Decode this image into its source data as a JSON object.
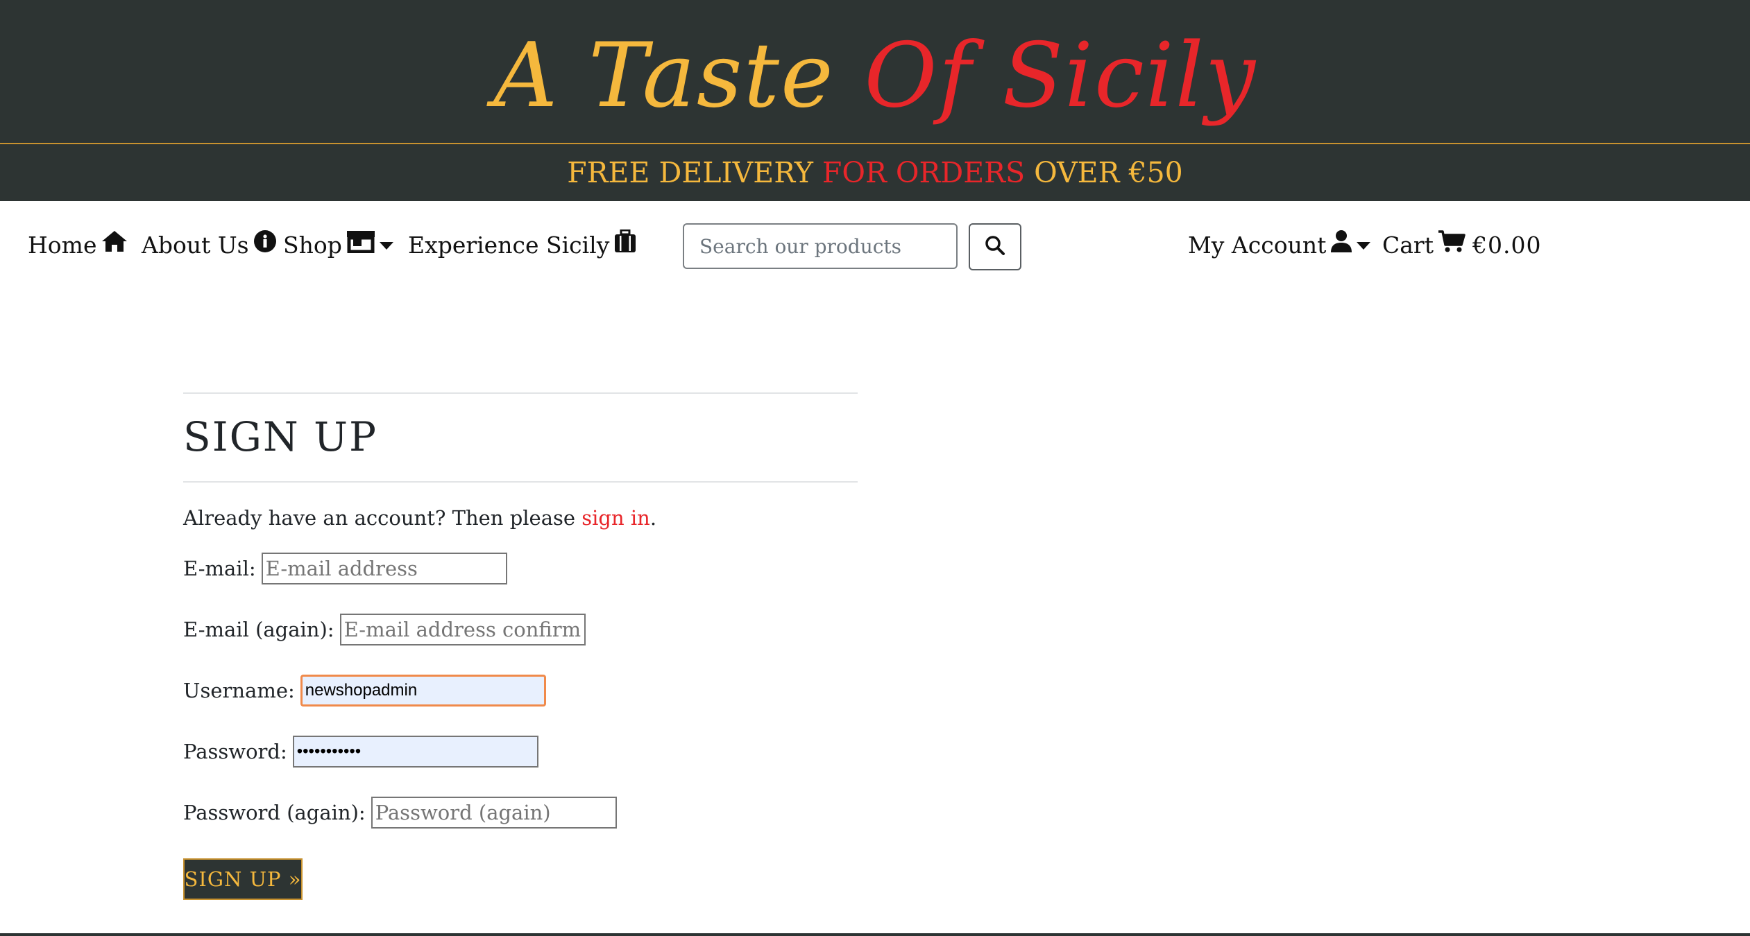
{
  "brand": {
    "title_part1": "A Taste Of",
    "title_part1a": "A Taste ",
    "title_part1b": "Of",
    "title_part2": "Sicily",
    "colors": {
      "dark": "#2d3433",
      "gold": "#f5b83d",
      "red": "#e8262a"
    }
  },
  "delivery_banner": {
    "part1": "FREE DELIVERY ",
    "part2": "FOR ORDERS",
    "part3": " OVER €50"
  },
  "nav": {
    "home": {
      "label": "Home",
      "icon": "home-icon"
    },
    "about": {
      "label": "About Us",
      "icon": "info-circle-icon"
    },
    "shop": {
      "label": "Shop",
      "icon": "store-icon"
    },
    "experience": {
      "label": "Experience Sicily",
      "icon": "suitcase-icon"
    },
    "search": {
      "placeholder": "Search our products",
      "button_icon": "search-icon"
    },
    "account": {
      "label": "My Account",
      "icon": "user-icon"
    },
    "cart": {
      "label": "Cart",
      "icon": "cart-icon",
      "total": "€0.00"
    }
  },
  "signup": {
    "title": "SIGN UP",
    "signin_prefix": "Already have an account? Then please ",
    "signin_link": "sign in",
    "signin_suffix": ".",
    "fields": [
      {
        "label": "E-mail:",
        "value": "",
        "placeholder": "E-mail address"
      },
      {
        "label": "E-mail (again):",
        "value": "",
        "placeholder": "E-mail address confirmation"
      },
      {
        "label": "Username:",
        "value": "newshopadmin",
        "placeholder": ""
      },
      {
        "label": "Password:",
        "value": "•••••••••••",
        "placeholder": ""
      },
      {
        "label": "Password (again):",
        "value": "",
        "placeholder": "Password (again)"
      }
    ],
    "submit_label": "SIGN UP »"
  }
}
